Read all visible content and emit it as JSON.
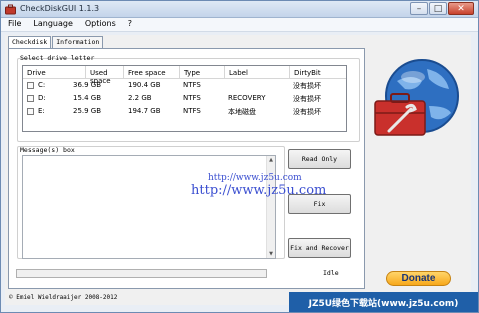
{
  "window": {
    "title": "CheckDiskGUI 1.1.3"
  },
  "menu": {
    "items": [
      "File",
      "Language",
      "Options",
      "?"
    ]
  },
  "tabs": [
    "Checkdisk",
    "Information"
  ],
  "drive_group": {
    "label": "Select drive letter"
  },
  "drive_table": {
    "columns": [
      "Drive",
      "Used space",
      "Free space",
      "Type",
      "Label",
      "DirtyBit"
    ],
    "rows": [
      {
        "drive": "C:",
        "used": "36.9 GB",
        "free": "190.4 GB",
        "type": "NTFS",
        "label": "",
        "dirty": "没有损坏"
      },
      {
        "drive": "D:",
        "used": "15.4 GB",
        "free": "2.2 GB",
        "type": "NTFS",
        "label": "RECOVERY",
        "dirty": "没有损坏"
      },
      {
        "drive": "E:",
        "used": "25.9 GB",
        "free": "194.7 GB",
        "type": "NTFS",
        "label": "本地磁盘",
        "dirty": "没有损坏"
      }
    ]
  },
  "message_group": {
    "label": "Message(s) box"
  },
  "buttons": {
    "read_only": "Read Only",
    "fix": "Fix",
    "fix_recover": "Fix and Recover"
  },
  "watermark": {
    "small": "http://www.jz5u.com",
    "big": "http://www.jz5u.com"
  },
  "status": {
    "text": "Idle"
  },
  "copyright": "© Emiel Wieldraaijer 2008-2012",
  "donate": "Donate",
  "banner": "JZ5U绿色下载站(www.jz5u.com)"
}
